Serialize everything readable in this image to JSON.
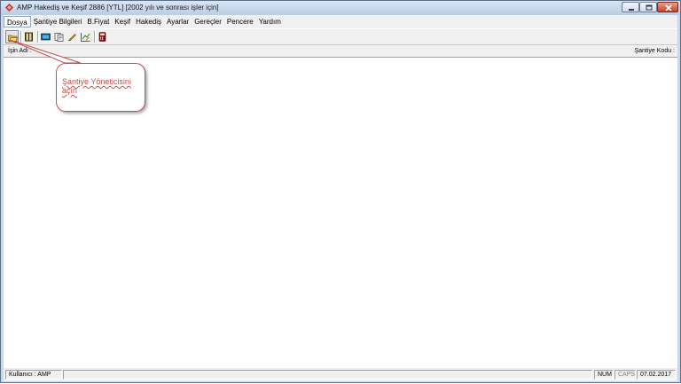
{
  "window": {
    "title": "AMP Hakediş ve Keşif 2886 [YTL] [2002 yılı ve sonrası işler için]"
  },
  "menu": {
    "items": [
      "Dosya",
      "Şantiye Bilgileri",
      "B.Fiyat",
      "Keşif",
      "Hakediş",
      "Ayarlar",
      "Gereçler",
      "Pencere",
      "Yardım"
    ]
  },
  "toolbar": {
    "icons": [
      "open-folder-icon",
      "book-icon",
      "monitor-icon",
      "clipboard-icon",
      "pencil-icon",
      "chart-edit-icon",
      "calculator-icon"
    ]
  },
  "infobar": {
    "isin_adi_label": "İşin Adı :",
    "santiye_kodu_label": "Şantiye Kodu :"
  },
  "callout": {
    "line1": "Şantiye Yöneticisini",
    "line2": "açın",
    "color": "#c0504d"
  },
  "statusbar": {
    "user": "Kullanıcı : AMP",
    "num": "NUM",
    "caps": "CAPS",
    "date": "07.02.2017"
  }
}
